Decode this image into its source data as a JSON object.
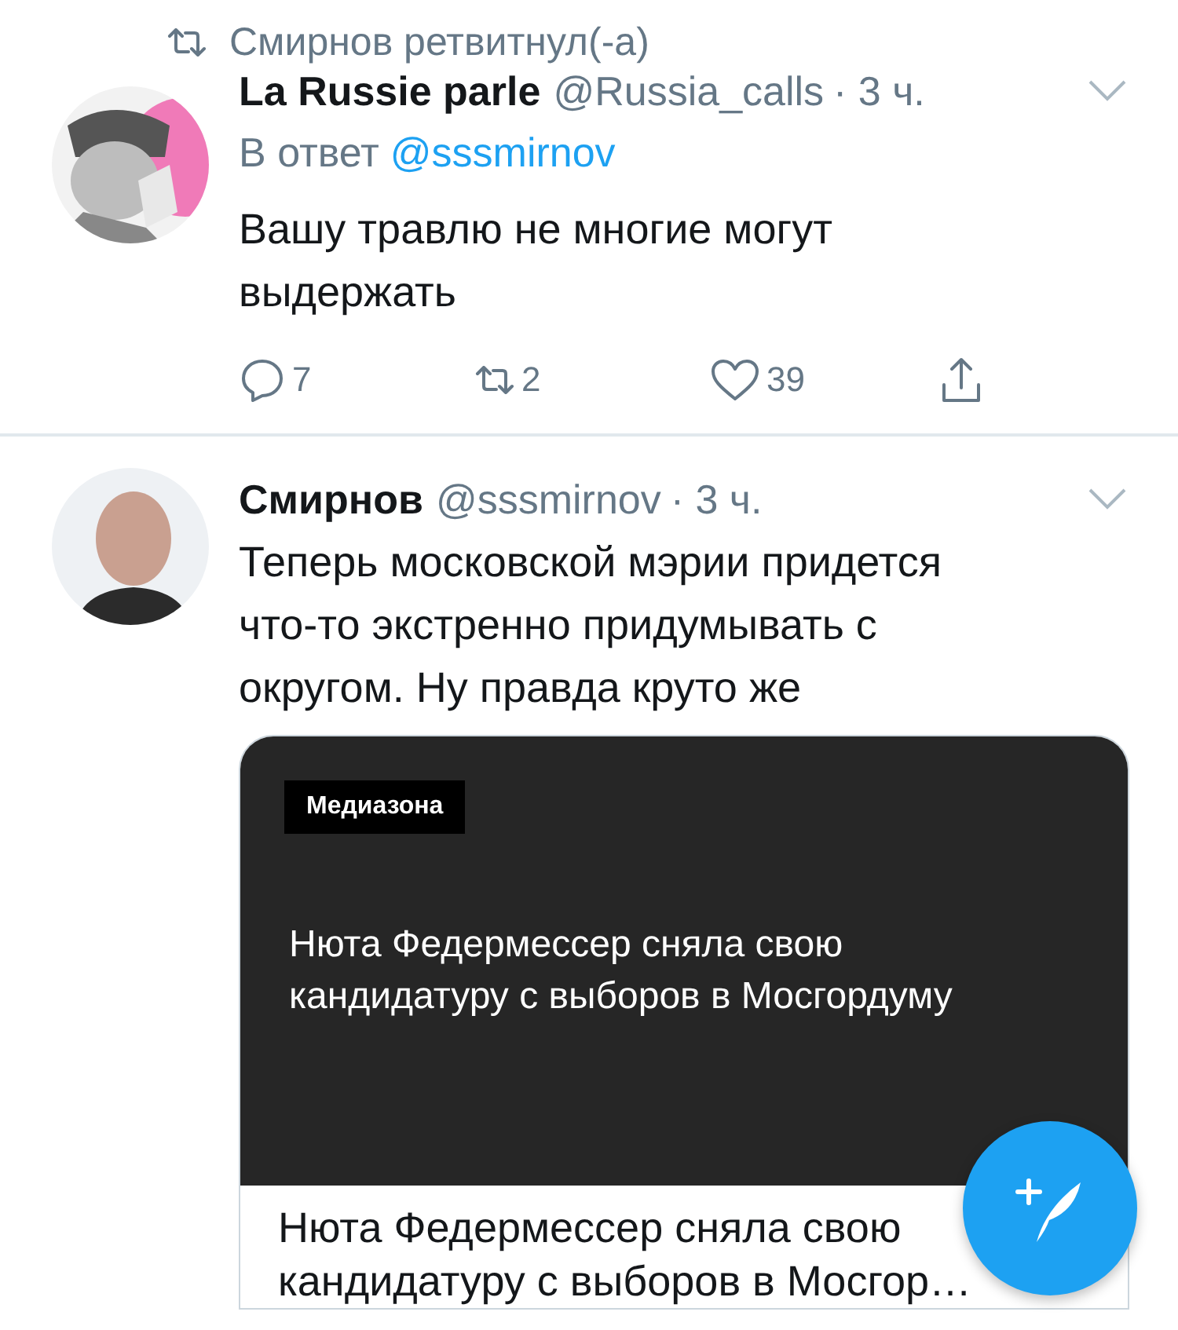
{
  "retweet_context": {
    "text": "Смирнов ретвитнул(-а)"
  },
  "tweets": [
    {
      "author": "La Russie parle",
      "handle": "@Russia_calls",
      "time": "· 3 ч.",
      "reply_to": {
        "label": "В ответ",
        "handle": "@sssmirnov"
      },
      "text_lines": [
        "Вашу травлю не многие могут",
        "выдержать"
      ],
      "actions": [
        {
          "kind": "reply",
          "count": "7"
        },
        {
          "kind": "retweet",
          "count": "2"
        },
        {
          "kind": "like",
          "count": "39"
        },
        {
          "kind": "share"
        }
      ]
    },
    {
      "author": "Смирнов",
      "handle": "@sssmirnov",
      "time": "· 3 ч.",
      "text_lines": [
        "Теперь московской мэрии придется",
        "что-то экстренно придумывать с",
        "округом. Ну правда круто же"
      ],
      "card": {
        "source": "Медиазона",
        "image_title_lines": [
          "Нюта Федермессер сняла свою",
          "кандидатуру с выборов в Мосгордуму"
        ],
        "title_lines": [
          "Нюта Федермессер сняла свою",
          "кандидатуру с выборов в Мосгор…"
        ]
      }
    }
  ]
}
